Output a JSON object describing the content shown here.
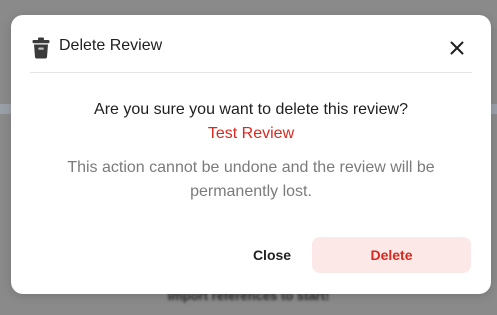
{
  "background": {
    "hint_text": "Import references to start!"
  },
  "dialog": {
    "title": "Delete Review",
    "question": "Are you sure you want to delete this review?",
    "review_name": "Test Review",
    "warning": "This action cannot be undone and the review will be permanently lost.",
    "close_label": "Close",
    "delete_label": "Delete",
    "title_icon": "trash-icon",
    "dismiss_icon": "close-icon"
  },
  "colors": {
    "accent_danger": "#d9281f",
    "danger_button_bg": "#fce8e6",
    "muted_text": "#7b7b7b"
  }
}
